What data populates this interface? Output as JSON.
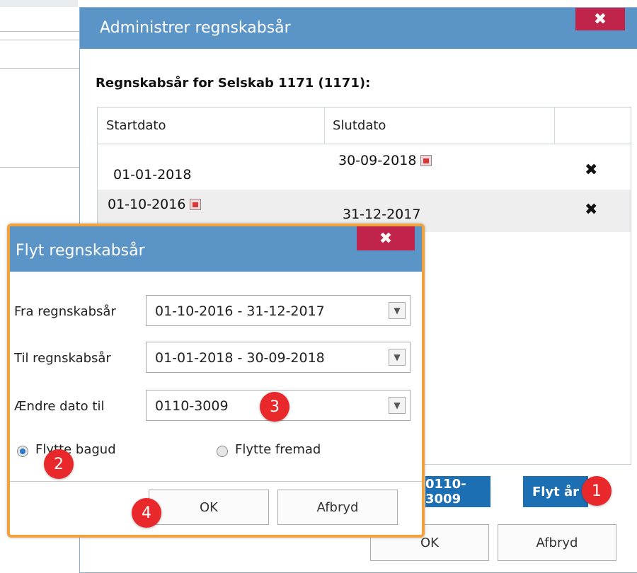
{
  "main_dialog": {
    "title": "Administrer regnskabsår",
    "close_glyph": "✖",
    "subtitle": "Regnskabsår for Selskab 1171 (1171):",
    "columns": [
      "Startdato",
      "Slutdato",
      ""
    ],
    "rows": [
      {
        "startdato": "01-01-2018",
        "slutdato": "30-09-2018",
        "calendar_on": "slutdato"
      },
      {
        "startdato": "01-10-2016",
        "slutdato": "31-12-2017",
        "calendar_on": "startdato"
      }
    ],
    "delete_glyph": "✖",
    "change_date_button": "0110-3009",
    "move_year_button": "Flyt år",
    "ok_button": "OK",
    "cancel_button": "Afbryd"
  },
  "flyt_dialog": {
    "title": "Flyt regnskabsår",
    "close_glyph": "✖",
    "fra_label": "Fra regnskabsår",
    "fra_value": "01-10-2016 - 31-12-2017",
    "til_label": "Til regnskabsår",
    "til_value": "01-01-2018 - 30-09-2018",
    "aendre_label": "Ændre dato til",
    "aendre_value": "0110-3009",
    "radio_back_label": "Flytte bagud",
    "radio_back_selected": true,
    "radio_forward_label": "Flytte fremad",
    "radio_forward_selected": false,
    "ok_button": "OK",
    "cancel_button": "Afbryd",
    "dropdown_glyph": "▼"
  },
  "markers": [
    "1",
    "2",
    "3",
    "4"
  ],
  "colors": {
    "header_blue": "#5b94c7",
    "close_red": "#c0244b",
    "primary_button": "#1c6fb3",
    "highlight_border": "#f0a23c",
    "marker_red": "#e8282b"
  },
  "icons": [
    "close-icon",
    "calendar-icon",
    "delete-icon",
    "dropdown-arrow-icon",
    "radio-icon"
  ]
}
